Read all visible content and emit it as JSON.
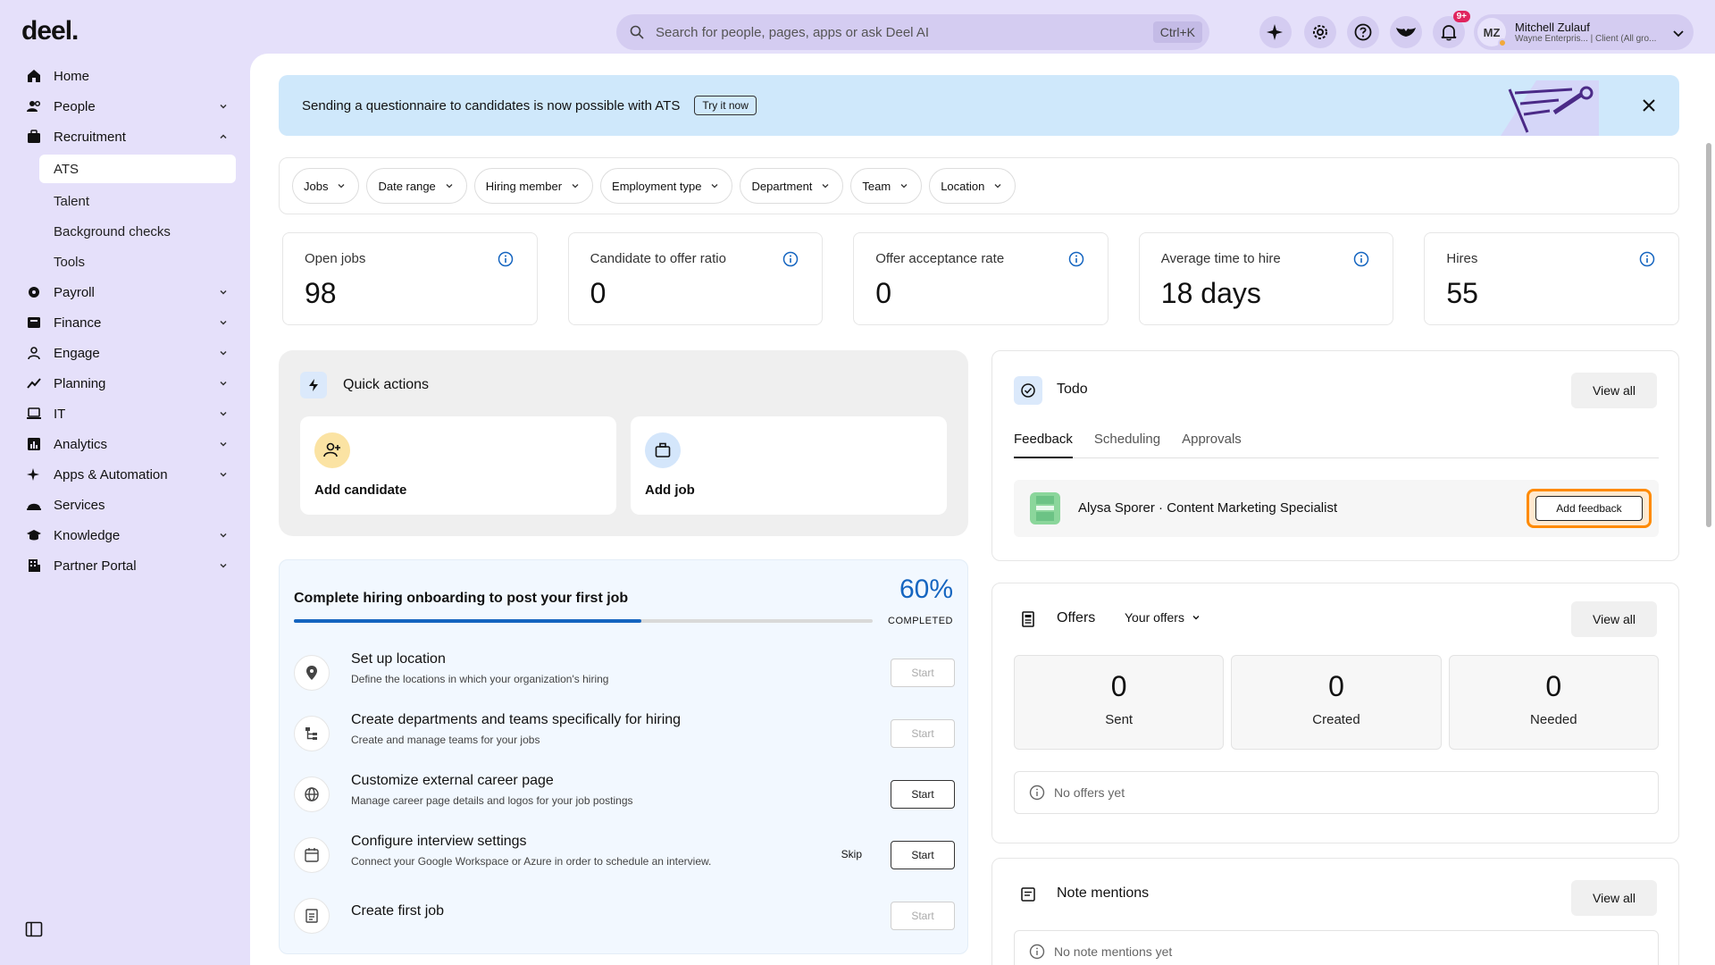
{
  "app": {
    "logo": "deel."
  },
  "sidebar": {
    "items": [
      {
        "label": "Home",
        "icon": "home-icon",
        "expandable": false
      },
      {
        "label": "People",
        "icon": "people-icon",
        "expandable": true
      },
      {
        "label": "Recruitment",
        "icon": "briefcase-icon",
        "expandable": true,
        "expanded": true
      },
      {
        "label": "Payroll",
        "icon": "payroll-icon",
        "expandable": true
      },
      {
        "label": "Finance",
        "icon": "finance-icon",
        "expandable": true
      },
      {
        "label": "Engage",
        "icon": "engage-icon",
        "expandable": true
      },
      {
        "label": "Planning",
        "icon": "planning-icon",
        "expandable": true
      },
      {
        "label": "IT",
        "icon": "laptop-icon",
        "expandable": true
      },
      {
        "label": "Analytics",
        "icon": "analytics-icon",
        "expandable": true
      },
      {
        "label": "Apps & Automation",
        "icon": "sparkle-icon",
        "expandable": true
      },
      {
        "label": "Services",
        "icon": "services-icon",
        "expandable": false
      },
      {
        "label": "Knowledge",
        "icon": "graduation-cap-icon",
        "expandable": true
      },
      {
        "label": "Partner Portal",
        "icon": "building-icon",
        "expandable": true
      }
    ],
    "recruitment_sub": [
      "ATS",
      "Talent",
      "Background checks",
      "Tools"
    ]
  },
  "topbar": {
    "search_placeholder": "Search for people, pages, apps or ask Deel AI",
    "search_shortcut": "Ctrl+K",
    "notification_count": "9+",
    "user": {
      "initials": "MZ",
      "name": "Mitchell Zulauf",
      "subtitle": "Wayne Enterpris... | Client (All gro..."
    }
  },
  "banner": {
    "text": "Sending a questionnaire to candidates is now possible with ATS",
    "button": "Try it now"
  },
  "filters": [
    "Jobs",
    "Date range",
    "Hiring member",
    "Employment type",
    "Department",
    "Team",
    "Location"
  ],
  "stats": [
    {
      "label": "Open jobs",
      "value": "98"
    },
    {
      "label": "Candidate to offer ratio",
      "value": "0"
    },
    {
      "label": "Offer acceptance rate",
      "value": "0"
    },
    {
      "label": "Average time to hire",
      "value": "18 days"
    },
    {
      "label": "Hires",
      "value": "55"
    }
  ],
  "quick_actions": {
    "title": "Quick actions",
    "add_candidate": "Add candidate",
    "add_job": "Add job"
  },
  "onboarding": {
    "title": "Complete hiring onboarding to post your first job",
    "percent_label": "60%",
    "progress": 0.6,
    "completed_label": "COMPLETED",
    "tasks": [
      {
        "title": "Set up location",
        "desc": "Define the locations in which your organization's hiring",
        "button": "Start",
        "enabled": false,
        "icon": "location-pin-icon"
      },
      {
        "title": "Create departments and teams specifically for hiring",
        "desc": "Create and manage teams for your jobs",
        "button": "Start",
        "enabled": false,
        "icon": "org-chart-icon"
      },
      {
        "title": "Customize external career page",
        "desc": "Manage career page details and logos for your job postings",
        "button": "Start",
        "enabled": true,
        "icon": "globe-icon"
      },
      {
        "title": "Configure interview settings",
        "desc": "Connect your Google Workspace or Azure in order to schedule an interview.",
        "button": "Start",
        "enabled": true,
        "skip": "Skip",
        "icon": "calendar-icon"
      },
      {
        "title": "Create first job",
        "desc": "",
        "button": "Start",
        "enabled": false,
        "icon": "job-post-icon"
      }
    ]
  },
  "todo": {
    "title": "Todo",
    "view_all": "View all",
    "tabs": [
      "Feedback",
      "Scheduling",
      "Approvals"
    ],
    "item_text": "Alysa Sporer · Content Marketing Specialist",
    "item_button": "Add feedback"
  },
  "offers": {
    "title": "Offers",
    "selector": "Your offers",
    "view_all": "View all",
    "cards": [
      {
        "value": "0",
        "label": "Sent"
      },
      {
        "value": "0",
        "label": "Created"
      },
      {
        "value": "0",
        "label": "Needed"
      }
    ],
    "empty": "No offers yet"
  },
  "notes": {
    "title": "Note mentions",
    "view_all": "View all",
    "empty": "No note mentions yet"
  },
  "colors": {
    "sidebar_bg": "#e5e0fa",
    "accent": "#1565c0",
    "highlight": "#ff8a00",
    "banner_bg": "#cfe8fb"
  }
}
